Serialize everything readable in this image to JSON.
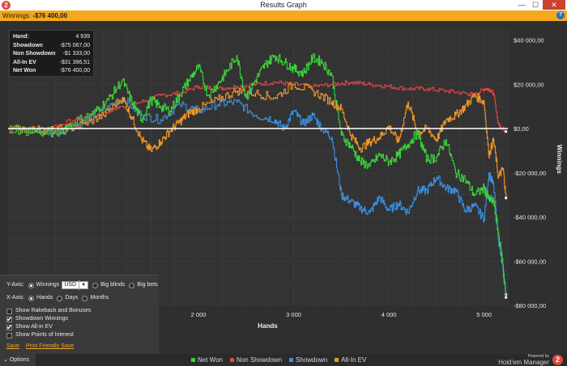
{
  "window": {
    "title": "Results Graph",
    "app_icon_label": "2",
    "min_label": "—",
    "max_label": "☐",
    "close_label": "✕"
  },
  "subbar": {
    "label": "Winnings:",
    "value": "-$76 400,00",
    "help_label": "?"
  },
  "tooltip": {
    "rows": [
      {
        "key": "Hand:",
        "value": "4 939"
      },
      {
        "key": "Showdown",
        "value": "-$75 067,00"
      },
      {
        "key": "Non Showdown",
        "value": "-$1 333,00"
      },
      {
        "key": "All-In EV",
        "value": "-$31 396,51"
      },
      {
        "key": "Net Won",
        "value": "-$76 400,00"
      }
    ]
  },
  "options": {
    "yaxis_label": "Y-Axis:",
    "yaxis_opts": [
      "Winnings",
      "Big blinds",
      "Big bets"
    ],
    "yaxis_selected": 0,
    "currency": "USD",
    "currency_dd": "▼",
    "xaxis_label": "X-Axis:",
    "xaxis_opts": [
      "Hands",
      "Days",
      "Months"
    ],
    "xaxis_selected": 0,
    "checks": [
      {
        "label": "Show Rakeback and Bonuses",
        "on": false
      },
      {
        "label": "Showdown Winnings",
        "on": true
      },
      {
        "label": "Show All-in EV",
        "on": true
      },
      {
        "label": "Show Points of Interest",
        "on": false
      }
    ],
    "save_link": "Save",
    "print_link": "Print Friendly Save",
    "tab_label": "Options",
    "tab_arrow": "⌄"
  },
  "footer": {
    "powered_by": "Powered by",
    "brand": "Hold'em Manager",
    "brand_icon": "2"
  },
  "colors": {
    "net_won": "#3bd13b",
    "non_showdown": "#e8443f",
    "showdown": "#3a8fe0",
    "all_in_ev": "#f0962a",
    "zero_line": "#ffffff",
    "grid": "#3f3f3f"
  },
  "chart_data": {
    "type": "line",
    "xlabel": "Hands",
    "ylabel": "Winnings",
    "xlim": [
      0,
      5250
    ],
    "ylim": [
      -80000,
      45000
    ],
    "x_ticks": [
      {
        "v": 2000,
        "label": "2 000"
      },
      {
        "v": 3000,
        "label": "3 000"
      },
      {
        "v": 4000,
        "label": "4 000"
      },
      {
        "v": 5000,
        "label": "5 000"
      }
    ],
    "y_ticks": [
      {
        "v": 40000,
        "label": "$40 000,00"
      },
      {
        "v": 20000,
        "label": "$20 000,00"
      },
      {
        "v": 0,
        "label": "$0,00"
      },
      {
        "v": -20000,
        "label": "-$20 000,00"
      },
      {
        "v": -40000,
        "label": "-$40 000,00"
      },
      {
        "v": -60000,
        "label": "-$60 000,00"
      },
      {
        "v": -80000,
        "label": "-$80 000,00"
      }
    ],
    "series": [
      {
        "name": "Net Won",
        "key": "net_won",
        "x": [
          0,
          300,
          500,
          700,
          900,
          1050,
          1200,
          1300,
          1400,
          1500,
          1600,
          1700,
          1800,
          1900,
          2000,
          2100,
          2200,
          2300,
          2400,
          2500,
          2600,
          2700,
          2800,
          2900,
          3000,
          3100,
          3200,
          3300,
          3400,
          3500,
          3600,
          3700,
          3800,
          3900,
          4000,
          4100,
          4200,
          4300,
          4400,
          4500,
          4600,
          4700,
          4800,
          4900,
          5000,
          5050,
          5100,
          5150,
          5200,
          5230
        ],
        "y": [
          0,
          -1500,
          -2000,
          3000,
          7000,
          13000,
          22000,
          12000,
          4000,
          13000,
          10000,
          8000,
          15000,
          22000,
          28000,
          15000,
          20000,
          26000,
          33000,
          14000,
          22000,
          29000,
          33000,
          30000,
          27000,
          25000,
          32000,
          30000,
          24000,
          -3000,
          -8000,
          -15000,
          -17000,
          -12000,
          -15000,
          -12000,
          -7000,
          -2000,
          -14000,
          -13000,
          -5000,
          -20000,
          -23000,
          -30000,
          -27000,
          -32000,
          -33000,
          -47000,
          -62000,
          -76400
        ]
      },
      {
        "name": "Non Showdown",
        "key": "non_showdown",
        "x": [
          0,
          400,
          700,
          1000,
          1200,
          1400,
          1600,
          1800,
          2000,
          2200,
          2400,
          2600,
          2800,
          3000,
          3200,
          3400,
          3600,
          3800,
          4000,
          4200,
          4400,
          4600,
          4800,
          4900,
          5000,
          5050,
          5100,
          5150,
          5200,
          5230
        ],
        "y": [
          0,
          0,
          4000,
          7000,
          10000,
          12000,
          15000,
          16000,
          19000,
          18000,
          19000,
          20000,
          21000,
          20000,
          19000,
          20000,
          21000,
          20000,
          19000,
          18000,
          18000,
          17000,
          16000,
          15000,
          18000,
          18000,
          16000,
          2000,
          0,
          -1333
        ]
      },
      {
        "name": "Showdown",
        "key": "showdown",
        "x": [
          0,
          300,
          500,
          800,
          1000,
          1200,
          1400,
          1600,
          1800,
          2000,
          2200,
          2400,
          2600,
          2800,
          2900,
          3000,
          3100,
          3200,
          3300,
          3400,
          3500,
          3600,
          3700,
          3800,
          3900,
          4000,
          4100,
          4200,
          4300,
          4400,
          4500,
          4600,
          4700,
          4800,
          4900,
          5000,
          5050,
          5100,
          5150,
          5200,
          5230
        ],
        "y": [
          0,
          -1000,
          -2000,
          3000,
          8000,
          14000,
          6000,
          4000,
          11000,
          8000,
          11000,
          12000,
          6000,
          4000,
          0,
          8000,
          2000,
          6000,
          0,
          -4000,
          -30000,
          -33000,
          -36000,
          -38000,
          -31000,
          -37000,
          -34000,
          -38000,
          -28000,
          -28000,
          -22000,
          -27000,
          -28000,
          -37000,
          -35000,
          -41000,
          -20000,
          -26000,
          -50000,
          -65000,
          -75067
        ]
      },
      {
        "name": "All-In EV",
        "key": "all_in_ev",
        "x": [
          0,
          300,
          500,
          800,
          1000,
          1200,
          1300,
          1400,
          1500,
          1600,
          1700,
          1800,
          1900,
          2000,
          2200,
          2400,
          2600,
          2800,
          3000,
          3200,
          3400,
          3500,
          3600,
          3700,
          3800,
          3900,
          4000,
          4100,
          4200,
          4300,
          4400,
          4500,
          4600,
          4700,
          4800,
          4900,
          5000,
          5050,
          5100,
          5150,
          5200,
          5230
        ],
        "y": [
          0,
          -500,
          -1000,
          2000,
          6000,
          14000,
          5000,
          -5000,
          -10000,
          -6000,
          -1000,
          3000,
          7000,
          9000,
          13000,
          17000,
          16000,
          14000,
          20000,
          17000,
          12000,
          9000,
          -3000,
          -9000,
          -6000,
          -4000,
          1000,
          -6000,
          12000,
          -2000,
          0,
          -5000,
          4000,
          6000,
          10000,
          15000,
          12000,
          -12000,
          -5000,
          -22000,
          -18000,
          -31397
        ]
      }
    ]
  }
}
